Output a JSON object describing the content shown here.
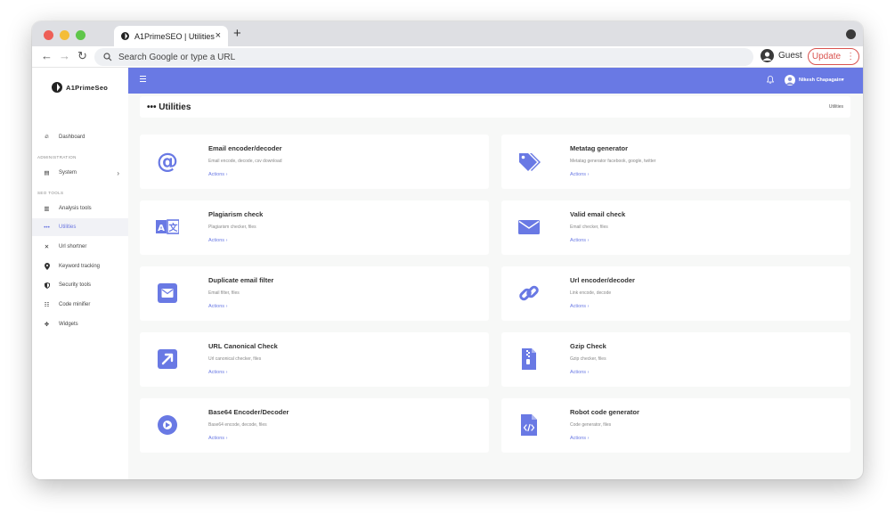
{
  "browser": {
    "tab_title": "A1PrimeSEO | Utilities",
    "tab_close": "×",
    "new_tab": "+",
    "address_placeholder": "Search Google or type a URL",
    "profile_label": "Guest",
    "update_label": "Update",
    "update_menu": "⋮",
    "back": "←",
    "forward": "→",
    "reload": "↻"
  },
  "sidebar": {
    "brand": "A1PrimeSeo",
    "dashboard": {
      "label": "Dashboard",
      "icon": "flame-icon"
    },
    "section_admin": "ADMINISTRATION",
    "system": {
      "label": "System",
      "icon": "server-icon",
      "chevron": "›"
    },
    "section_seo": "SEO TOOLS",
    "items": [
      {
        "label": "Analysis tools",
        "icon": "chart-icon",
        "glyph": "▥"
      },
      {
        "label": "Utilities",
        "icon": "dots-icon",
        "glyph": "•••"
      },
      {
        "label": "Url shortner",
        "icon": "close-icon",
        "glyph": "✕"
      },
      {
        "label": "Keyword tracking",
        "icon": "pin-icon",
        "glyph": "⬤"
      },
      {
        "label": "Security tools",
        "icon": "shield-icon",
        "glyph": "◗"
      },
      {
        "label": "Code minifier",
        "icon": "code-icon",
        "glyph": "☷"
      },
      {
        "label": "Widgets",
        "icon": "puzzle-icon",
        "glyph": "✥"
      }
    ]
  },
  "header": {
    "user_name": "Nikesh Chapagain",
    "caret": "▾"
  },
  "page": {
    "title": "••• Utilities",
    "breadcrumb": "Utilities"
  },
  "cards": [
    {
      "title": "Email encoder/decoder",
      "desc": "Email encode, decode, csv download",
      "action": "Actions  ›",
      "icon": "at-icon"
    },
    {
      "title": "Metatag generator",
      "desc": "Metatag generator facebook, google, twitter",
      "action": "Actions  ›",
      "icon": "tags-icon"
    },
    {
      "title": "Plagiarism check",
      "desc": "Plagiarism checker, files",
      "action": "Actions  ›",
      "icon": "translate-icon"
    },
    {
      "title": "Valid email check",
      "desc": "Email checker, files",
      "action": "Actions  ›",
      "icon": "envelope-icon"
    },
    {
      "title": "Duplicate email filter",
      "desc": "Email filter, files",
      "action": "Actions  ›",
      "icon": "envelope-square-icon"
    },
    {
      "title": "Url encoder/decoder",
      "desc": "Link encode, decode",
      "action": "Actions  ›",
      "icon": "link-icon"
    },
    {
      "title": "URL Canonical Check",
      "desc": "Url canonical checker, files",
      "action": "Actions  ›",
      "icon": "external-link-icon"
    },
    {
      "title": "Gzip Check",
      "desc": "Gzip checker, files",
      "action": "Actions  ›",
      "icon": "file-zip-icon"
    },
    {
      "title": "Base64 Encoder/Decoder",
      "desc": "Base64 encode, decode, files",
      "action": "Actions  ›",
      "icon": "play-circle-icon"
    },
    {
      "title": "Robot code generator",
      "desc": "Code generator, files",
      "action": "Actions  ›",
      "icon": "file-code-icon"
    }
  ],
  "colors": {
    "accent": "#6979e4",
    "update": "#d9534f"
  }
}
